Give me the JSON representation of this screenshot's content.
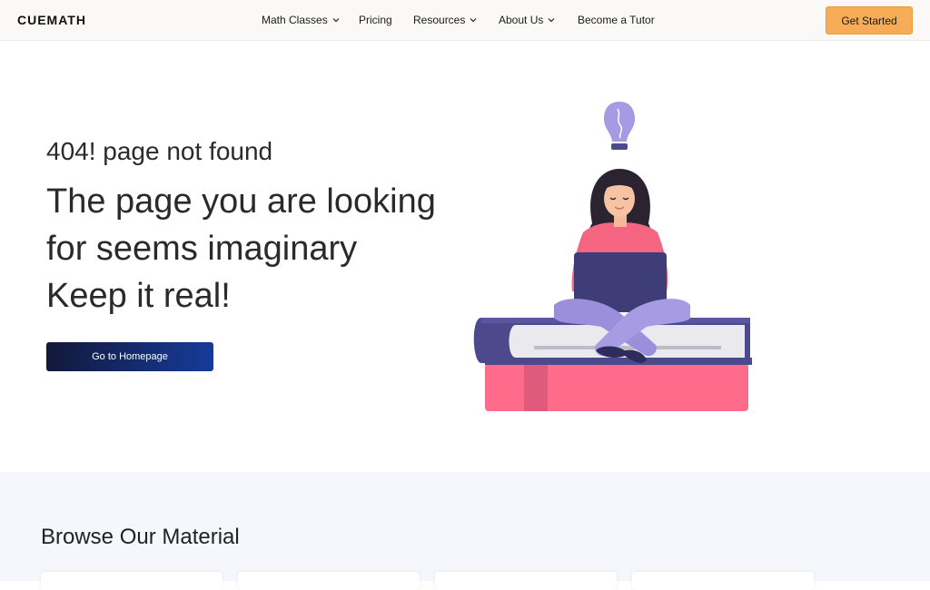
{
  "header": {
    "logo": "CUEMATH",
    "nav": [
      {
        "label": "Math Classes",
        "has_dropdown": true
      },
      {
        "label": "Pricing",
        "has_dropdown": false
      },
      {
        "label": "Resources",
        "has_dropdown": true
      },
      {
        "label": "About Us",
        "has_dropdown": true
      },
      {
        "label": "Become a Tutor",
        "has_dropdown": false
      }
    ],
    "cta_label": "Get Started"
  },
  "hero": {
    "error_code": "404! page not found",
    "headline_lines": [
      "The page you are looking",
      "for seems imaginary",
      "Keep it real!"
    ],
    "button_label": "Go to Homepage"
  },
  "material": {
    "title": "Browse Our Material"
  },
  "colors": {
    "accent_orange": "#f6ad55",
    "button_navy": "#12193a",
    "book_pink": "#ff6b8b",
    "book_indigo": "#4c4a8c",
    "lavender": "#9b8fdc"
  }
}
